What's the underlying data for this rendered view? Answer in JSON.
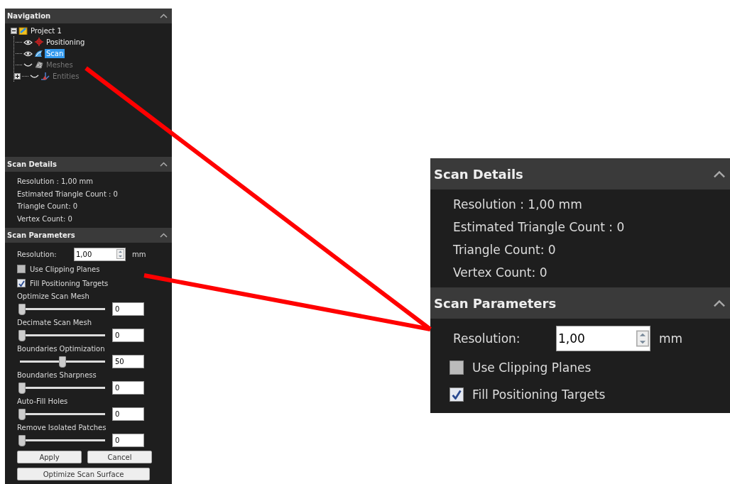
{
  "navigation": {
    "title": "Navigation",
    "tree": [
      {
        "label": "Project 1",
        "kind": "project",
        "expanded": true,
        "children": [
          {
            "label": "Positioning",
            "kind": "positioning",
            "visible": true,
            "disabled": false,
            "selected": false
          },
          {
            "label": "Scan",
            "kind": "scan",
            "visible": true,
            "disabled": false,
            "selected": true
          },
          {
            "label": "Meshes",
            "kind": "meshes",
            "visible": false,
            "disabled": true,
            "selected": false
          },
          {
            "label": "Entities",
            "kind": "entities",
            "visible": false,
            "disabled": true,
            "selected": false,
            "expanded": false
          }
        ]
      }
    ]
  },
  "scan_details": {
    "title": "Scan Details",
    "lines": [
      "Resolution : 1,00 mm",
      "Estimated Triangle Count : 0",
      "Triangle Count: 0",
      "Vertex Count: 0"
    ]
  },
  "scan_parameters": {
    "title": "Scan Parameters",
    "resolution": {
      "label": "Resolution:",
      "value": "1,00",
      "unit": "mm"
    },
    "checkboxes": [
      {
        "label": "Use Clipping Planes",
        "checked": false
      },
      {
        "label": "Fill Positioning Targets",
        "checked": true
      }
    ],
    "sliders": [
      {
        "label": "Optimize Scan Mesh",
        "level": 0,
        "value": "0"
      },
      {
        "label": "Decimate Scan Mesh",
        "level": 0,
        "value": "0"
      },
      {
        "label": "Boundaries Optimization",
        "level": 0.5,
        "value": "50"
      },
      {
        "label": "Boundaries Sharpness",
        "level": 0,
        "value": "0"
      },
      {
        "label": "Auto-Fill Holes",
        "level": 0,
        "value": "0"
      },
      {
        "label": "Remove Isolated Patches",
        "level": 0,
        "value": "0"
      }
    ],
    "buttons": [
      "Apply",
      "Cancel"
    ],
    "wide_button": "Optimize Scan Surface"
  },
  "inset": {
    "scan_details": {
      "title": "Scan Details",
      "lines": [
        "Resolution : 1,00 mm",
        "Estimated Triangle Count : 0",
        "Triangle Count: 0",
        "Vertex Count: 0"
      ]
    },
    "scan_parameters": {
      "title": "Scan Parameters",
      "resolution": {
        "label": "Resolution:",
        "value": "1,00",
        "unit": "mm"
      },
      "checkboxes": [
        {
          "label": "Use Clipping Planes",
          "checked": false
        },
        {
          "label": "Fill Positioning Targets",
          "checked": true
        }
      ]
    }
  }
}
